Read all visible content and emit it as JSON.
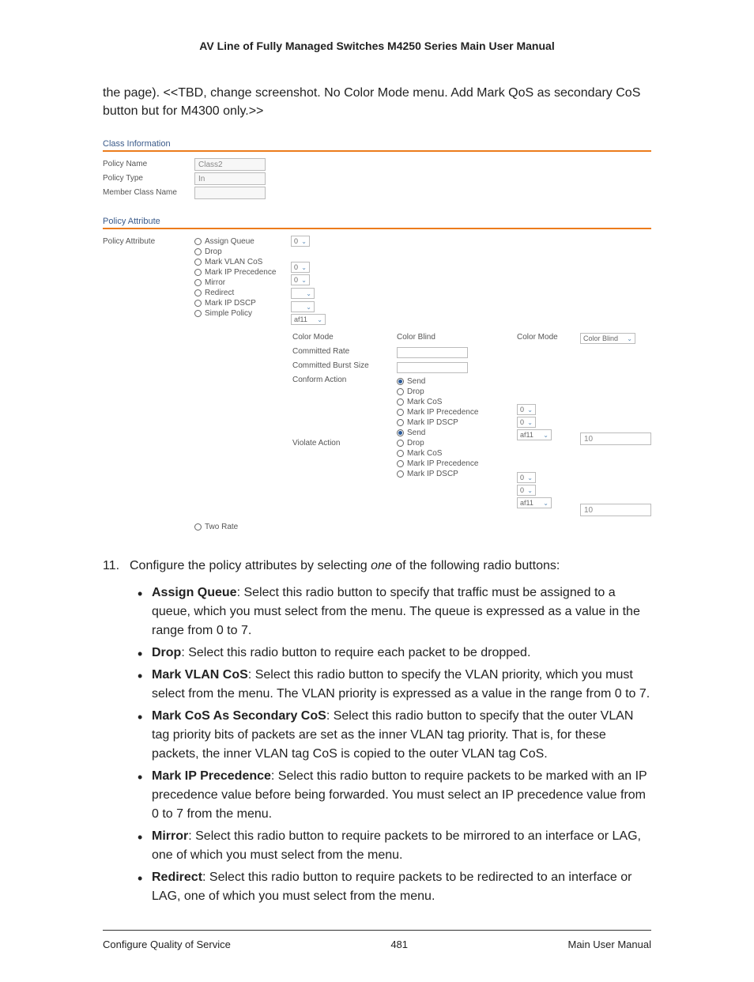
{
  "header": {
    "title": "AV Line of Fully Managed Switches M4250 Series Main User Manual"
  },
  "intro": "the page). <<TBD, change screenshot. No Color Mode menu. Add Mark QoS as secondary CoS button but for M4300 only.>>",
  "shot": {
    "section1": "Class Information",
    "section2": "Policy Attribute",
    "fields": {
      "policy_name_label": "Policy Name",
      "policy_name_value": "Class2",
      "policy_type_label": "Policy Type",
      "policy_type_value": "In",
      "member_class_label": "Member Class Name",
      "member_class_value": ""
    },
    "attr_label": "Policy Attribute",
    "options": [
      "Assign Queue",
      "Drop",
      "Mark VLAN CoS",
      "Mark IP Precedence",
      "Mirror",
      "Redirect",
      "Mark IP DSCP",
      "Simple Policy"
    ],
    "dd_zero": "0",
    "dd_af11": "af11",
    "simple": {
      "color_mode": "Color Mode",
      "committed_rate": "Committed Rate",
      "committed_burst": "Committed Burst Size",
      "conform_action": "Conform Action",
      "violate_action": "Violate Action",
      "color_blind": "Color Blind",
      "sub_opts": {
        "send": "Send",
        "drop": "Drop",
        "mark_cos": "Mark CoS",
        "mark_ip_prec": "Mark IP Precedence",
        "mark_ip_dscp": "Mark IP DSCP"
      },
      "val_10": "10",
      "two_rate": "Two Rate"
    }
  },
  "step": {
    "num": "11.",
    "prefix": "Configure the policy attributes by selecting ",
    "italic": "one",
    "suffix": " of the following radio buttons:"
  },
  "bullets": [
    {
      "bold": "Assign Queue",
      "text": ": Select this radio button to specify that traffic must be assigned to a queue, which you must select from the menu. The queue is expressed as a value in the range from 0 to 7."
    },
    {
      "bold": "Drop",
      "text": ": Select this radio button to require each packet to be dropped."
    },
    {
      "bold": "Mark VLAN CoS",
      "text": ": Select this radio button to specify the VLAN priority, which you must select from the menu. The VLAN priority is expressed as a value in the range from 0 to 7."
    },
    {
      "bold": "Mark CoS As Secondary CoS",
      "text": ": Select this radio button to specify that the outer VLAN tag priority bits of packets are set as the inner VLAN tag priority. That is, for these packets, the inner VLAN tag CoS is copied to the outer VLAN tag CoS."
    },
    {
      "bold": "Mark IP Precedence",
      "text": ": Select this radio button to require packets to be marked with an IP precedence value before being forwarded. You must select an IP precedence value from 0 to 7 from the menu."
    },
    {
      "bold": "Mirror",
      "text": ": Select this radio button to require packets to be mirrored to an interface or LAG, one of which you must select from the menu."
    },
    {
      "bold": "Redirect",
      "text": ": Select this radio button to require packets to be redirected to an interface or LAG, one of which you must select from the menu."
    }
  ],
  "footer": {
    "left": "Configure Quality of Service",
    "center": "481",
    "right": "Main User Manual"
  }
}
